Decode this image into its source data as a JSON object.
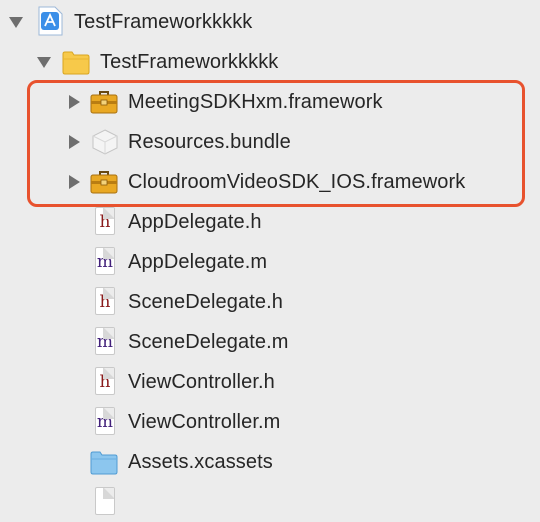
{
  "navigator": {
    "project": {
      "label": "TestFrameworkkkkk",
      "icon": "xcode-project-icon",
      "expanded": true
    },
    "group": {
      "label": "TestFrameworkkkkk",
      "icon": "folder-icon",
      "expanded": true
    },
    "items": [
      {
        "label": "MeetingSDKHxm.framework",
        "icon": "framework-toolbox-icon"
      },
      {
        "label": "Resources.bundle",
        "icon": "bundle-icon"
      },
      {
        "label": "CloudroomVideoSDK_IOS.framework",
        "icon": "framework-toolbox-icon"
      },
      {
        "label": "AppDelegate.h",
        "icon": "header-file-icon",
        "glyph": "h"
      },
      {
        "label": "AppDelegate.m",
        "icon": "objc-file-icon",
        "glyph": "m"
      },
      {
        "label": "SceneDelegate.h",
        "icon": "header-file-icon",
        "glyph": "h"
      },
      {
        "label": "SceneDelegate.m",
        "icon": "objc-file-icon",
        "glyph": "m"
      },
      {
        "label": "ViewController.h",
        "icon": "header-file-icon",
        "glyph": "h"
      },
      {
        "label": "ViewController.m",
        "icon": "objc-file-icon",
        "glyph": "m"
      },
      {
        "label": "Assets.xcassets",
        "icon": "assets-folder-icon"
      }
    ]
  },
  "colors": {
    "highlight": "#e8522e",
    "background": "#ececec",
    "header_glyph": "#8a1b1b",
    "impl_glyph": "#42207a"
  }
}
